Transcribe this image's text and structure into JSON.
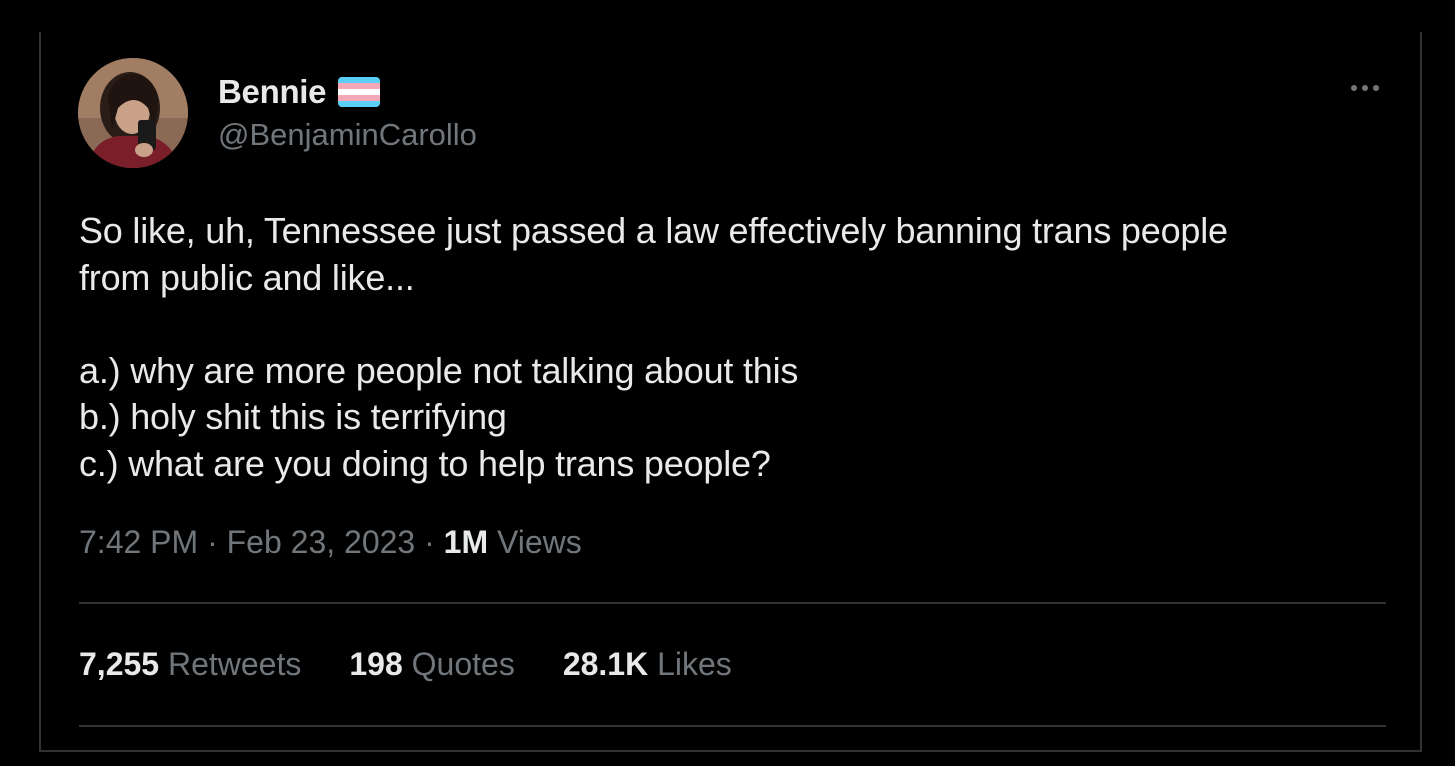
{
  "author": {
    "display_name": "Bennie",
    "handle": "@BenjaminCarollo",
    "flag_icon": "transgender-flag-icon",
    "avatar_icon": "profile-photo"
  },
  "tweet": {
    "text": "So like, uh, Tennessee just passed a law effectively banning trans people\nfrom public and like...\n\na.) why are more people not talking about this\nb.) holy shit this is terrifying\nc.) what are you doing to help trans people?",
    "time": "7:42 PM",
    "date": "Feb 23, 2023",
    "separator": "·",
    "views_count": "1M",
    "views_label": "Views"
  },
  "stats": {
    "retweets": {
      "count": "7,255",
      "label": "Retweets"
    },
    "quotes": {
      "count": "198",
      "label": "Quotes"
    },
    "likes": {
      "count": "28.1K",
      "label": "Likes"
    }
  },
  "menu": {
    "more_icon": "more-horizontal-icon"
  },
  "colors": {
    "background": "#000000",
    "primary_text": "#e7e9ea",
    "secondary_text": "#71767b",
    "border": "#2f3336",
    "flag_blue": "#5bcefa",
    "flag_pink": "#f5a9b8",
    "flag_white": "#ffffff"
  }
}
